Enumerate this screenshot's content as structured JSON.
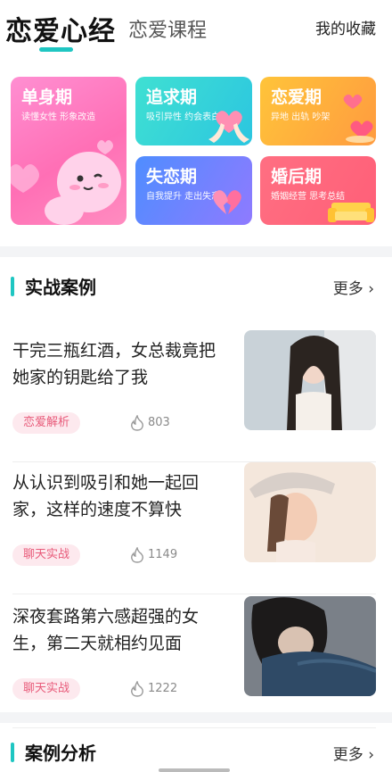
{
  "header": {
    "active_tab": "恋爱心经",
    "inactive_tab": "恋爱课程",
    "favorites": "我的收藏"
  },
  "stages": {
    "single": {
      "title": "单身期",
      "subtitle": "读懂女性 形象改造"
    },
    "pursue": {
      "title": "追求期",
      "subtitle": "吸引异性 约会表白"
    },
    "love": {
      "title": "恋爱期",
      "subtitle": "异地 出轨 吵架"
    },
    "breakup": {
      "title": "失恋期",
      "subtitle": "自我提升 走出失恋"
    },
    "married": {
      "title": "婚后期",
      "subtitle": "婚姻经营 思考总结"
    }
  },
  "section_cases": {
    "title": "实战案例",
    "more": "更多 ›"
  },
  "cases": [
    {
      "title": "干完三瓶红酒，女总裁竟把她家的钥匙给了我",
      "tag": "恋爱解析",
      "views": "803"
    },
    {
      "title": "从认识到吸引和她一起回家，这样的速度不算快",
      "tag": "聊天实战",
      "views": "1149"
    },
    {
      "title": "深夜套路第六感超强的女生，第二天就相约见面",
      "tag": "聊天实战",
      "views": "1222"
    }
  ],
  "section_analysis": {
    "title": "案例分析",
    "more": "更多 ›"
  },
  "colors": {
    "accent": "#1fc6c2",
    "tag_bg": "#fde9ee",
    "tag_text": "#e85b7a"
  }
}
